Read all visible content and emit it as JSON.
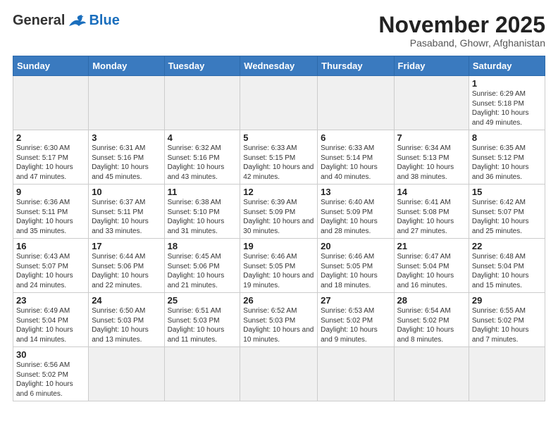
{
  "header": {
    "logo_general": "General",
    "logo_blue": "Blue",
    "title": "November 2025",
    "location": "Pasaband, Ghowr, Afghanistan"
  },
  "weekdays": [
    "Sunday",
    "Monday",
    "Tuesday",
    "Wednesday",
    "Thursday",
    "Friday",
    "Saturday"
  ],
  "weeks": [
    [
      {
        "day": "",
        "info": ""
      },
      {
        "day": "",
        "info": ""
      },
      {
        "day": "",
        "info": ""
      },
      {
        "day": "",
        "info": ""
      },
      {
        "day": "",
        "info": ""
      },
      {
        "day": "",
        "info": ""
      },
      {
        "day": "1",
        "info": "Sunrise: 6:29 AM\nSunset: 5:18 PM\nDaylight: 10 hours\nand 49 minutes."
      }
    ],
    [
      {
        "day": "2",
        "info": "Sunrise: 6:30 AM\nSunset: 5:17 PM\nDaylight: 10 hours\nand 47 minutes."
      },
      {
        "day": "3",
        "info": "Sunrise: 6:31 AM\nSunset: 5:16 PM\nDaylight: 10 hours\nand 45 minutes."
      },
      {
        "day": "4",
        "info": "Sunrise: 6:32 AM\nSunset: 5:16 PM\nDaylight: 10 hours\nand 43 minutes."
      },
      {
        "day": "5",
        "info": "Sunrise: 6:33 AM\nSunset: 5:15 PM\nDaylight: 10 hours\nand 42 minutes."
      },
      {
        "day": "6",
        "info": "Sunrise: 6:33 AM\nSunset: 5:14 PM\nDaylight: 10 hours\nand 40 minutes."
      },
      {
        "day": "7",
        "info": "Sunrise: 6:34 AM\nSunset: 5:13 PM\nDaylight: 10 hours\nand 38 minutes."
      },
      {
        "day": "8",
        "info": "Sunrise: 6:35 AM\nSunset: 5:12 PM\nDaylight: 10 hours\nand 36 minutes."
      }
    ],
    [
      {
        "day": "9",
        "info": "Sunrise: 6:36 AM\nSunset: 5:11 PM\nDaylight: 10 hours\nand 35 minutes."
      },
      {
        "day": "10",
        "info": "Sunrise: 6:37 AM\nSunset: 5:11 PM\nDaylight: 10 hours\nand 33 minutes."
      },
      {
        "day": "11",
        "info": "Sunrise: 6:38 AM\nSunset: 5:10 PM\nDaylight: 10 hours\nand 31 minutes."
      },
      {
        "day": "12",
        "info": "Sunrise: 6:39 AM\nSunset: 5:09 PM\nDaylight: 10 hours\nand 30 minutes."
      },
      {
        "day": "13",
        "info": "Sunrise: 6:40 AM\nSunset: 5:09 PM\nDaylight: 10 hours\nand 28 minutes."
      },
      {
        "day": "14",
        "info": "Sunrise: 6:41 AM\nSunset: 5:08 PM\nDaylight: 10 hours\nand 27 minutes."
      },
      {
        "day": "15",
        "info": "Sunrise: 6:42 AM\nSunset: 5:07 PM\nDaylight: 10 hours\nand 25 minutes."
      }
    ],
    [
      {
        "day": "16",
        "info": "Sunrise: 6:43 AM\nSunset: 5:07 PM\nDaylight: 10 hours\nand 24 minutes."
      },
      {
        "day": "17",
        "info": "Sunrise: 6:44 AM\nSunset: 5:06 PM\nDaylight: 10 hours\nand 22 minutes."
      },
      {
        "day": "18",
        "info": "Sunrise: 6:45 AM\nSunset: 5:06 PM\nDaylight: 10 hours\nand 21 minutes."
      },
      {
        "day": "19",
        "info": "Sunrise: 6:46 AM\nSunset: 5:05 PM\nDaylight: 10 hours\nand 19 minutes."
      },
      {
        "day": "20",
        "info": "Sunrise: 6:46 AM\nSunset: 5:05 PM\nDaylight: 10 hours\nand 18 minutes."
      },
      {
        "day": "21",
        "info": "Sunrise: 6:47 AM\nSunset: 5:04 PM\nDaylight: 10 hours\nand 16 minutes."
      },
      {
        "day": "22",
        "info": "Sunrise: 6:48 AM\nSunset: 5:04 PM\nDaylight: 10 hours\nand 15 minutes."
      }
    ],
    [
      {
        "day": "23",
        "info": "Sunrise: 6:49 AM\nSunset: 5:04 PM\nDaylight: 10 hours\nand 14 minutes."
      },
      {
        "day": "24",
        "info": "Sunrise: 6:50 AM\nSunset: 5:03 PM\nDaylight: 10 hours\nand 13 minutes."
      },
      {
        "day": "25",
        "info": "Sunrise: 6:51 AM\nSunset: 5:03 PM\nDaylight: 10 hours\nand 11 minutes."
      },
      {
        "day": "26",
        "info": "Sunrise: 6:52 AM\nSunset: 5:03 PM\nDaylight: 10 hours\nand 10 minutes."
      },
      {
        "day": "27",
        "info": "Sunrise: 6:53 AM\nSunset: 5:02 PM\nDaylight: 10 hours\nand 9 minutes."
      },
      {
        "day": "28",
        "info": "Sunrise: 6:54 AM\nSunset: 5:02 PM\nDaylight: 10 hours\nand 8 minutes."
      },
      {
        "day": "29",
        "info": "Sunrise: 6:55 AM\nSunset: 5:02 PM\nDaylight: 10 hours\nand 7 minutes."
      }
    ],
    [
      {
        "day": "30",
        "info": "Sunrise: 6:56 AM\nSunset: 5:02 PM\nDaylight: 10 hours\nand 6 minutes."
      },
      {
        "day": "",
        "info": ""
      },
      {
        "day": "",
        "info": ""
      },
      {
        "day": "",
        "info": ""
      },
      {
        "day": "",
        "info": ""
      },
      {
        "day": "",
        "info": ""
      },
      {
        "day": "",
        "info": ""
      }
    ]
  ]
}
